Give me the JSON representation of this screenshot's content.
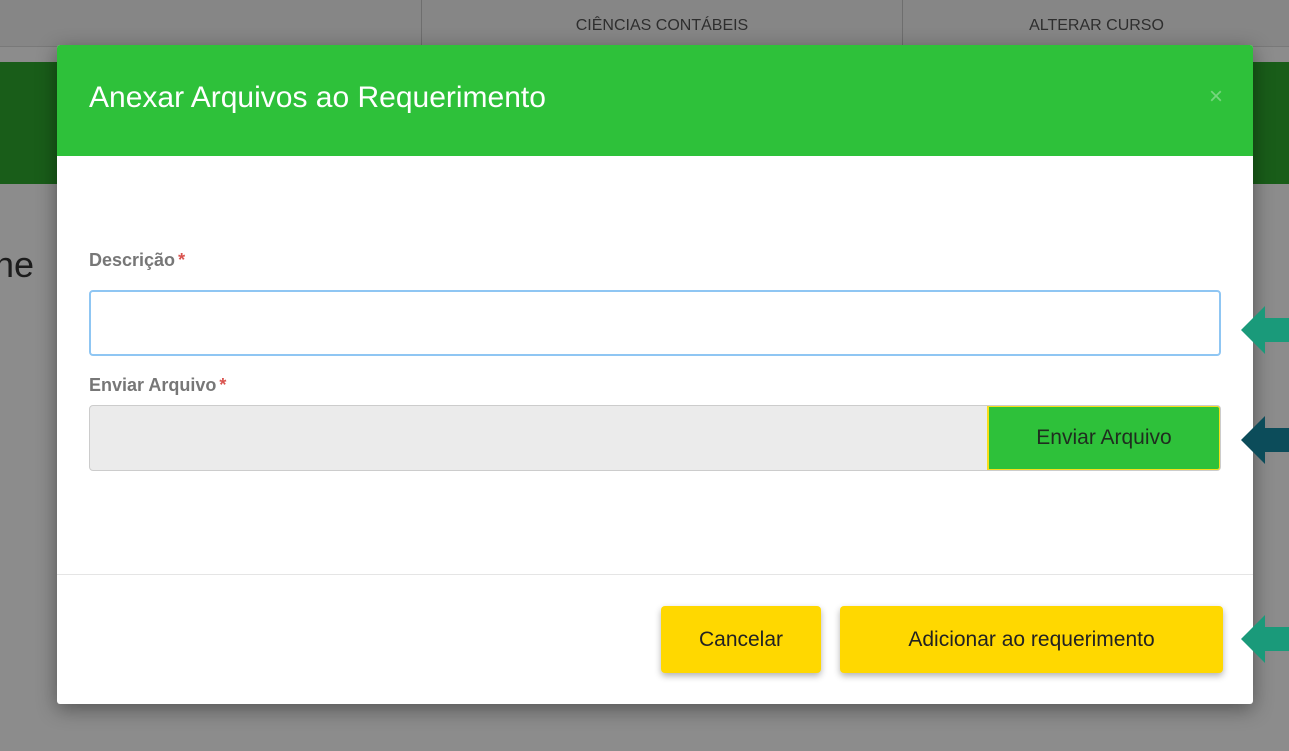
{
  "background": {
    "tabs": [
      "CIÊNCIAS CONTÁBEIS",
      "ALTERAR CURSO"
    ],
    "partial_title": "ne"
  },
  "modal": {
    "title": "Anexar Arquivos ao Requerimento",
    "close_icon": "×",
    "description_label": "Descrição",
    "required_mark": "*",
    "description_value": "",
    "file_label": "Enviar Arquivo",
    "file_button": "Enviar Arquivo",
    "cancel_button": "Cancelar",
    "submit_button": "Adicionar ao requerimento"
  },
  "colors": {
    "header_green": "#2ec13a",
    "band_green": "#2ea92e",
    "button_yellow": "#ffd800",
    "arrow_teal": "#1a9a7a",
    "arrow_dark_teal": "#0c4c5a",
    "required_red": "#d9534f"
  },
  "annotations": [
    "arrow-left-icon",
    "arrow-left-icon",
    "arrow-left-icon"
  ]
}
